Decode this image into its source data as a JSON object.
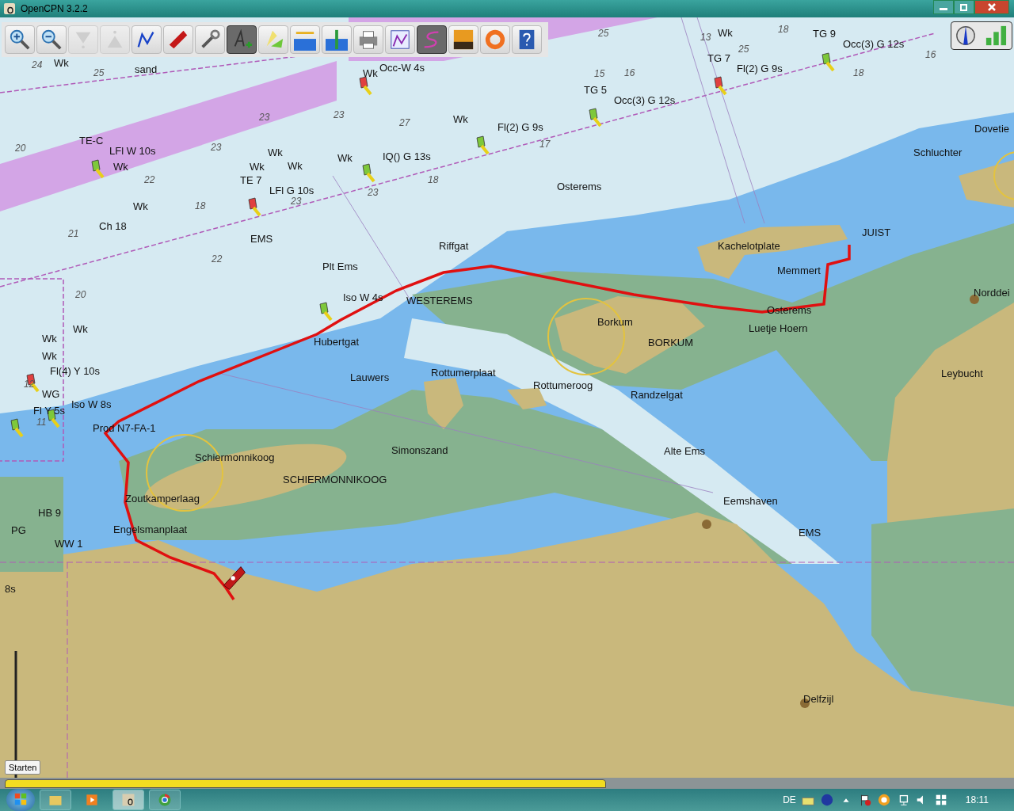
{
  "window": {
    "title": "OpenCPN 3.2.2"
  },
  "toolbar": {
    "tools": [
      {
        "kind": "zoom-in",
        "selected": false,
        "disabled": false
      },
      {
        "kind": "zoom-out",
        "selected": false,
        "disabled": false
      },
      {
        "kind": "scale-down",
        "selected": false,
        "disabled": true
      },
      {
        "kind": "scale-up",
        "selected": false,
        "disabled": true
      },
      {
        "kind": "route",
        "selected": false,
        "disabled": false
      },
      {
        "kind": "ship",
        "selected": false,
        "disabled": false
      },
      {
        "kind": "settings",
        "selected": false,
        "disabled": false
      },
      {
        "kind": "text",
        "selected": true,
        "disabled": false
      },
      {
        "kind": "lights",
        "selected": false,
        "disabled": false
      },
      {
        "kind": "tide",
        "selected": false,
        "disabled": false
      },
      {
        "kind": "current",
        "selected": false,
        "disabled": false
      },
      {
        "kind": "print",
        "selected": false,
        "disabled": false
      },
      {
        "kind": "route-manager",
        "selected": false,
        "disabled": false
      },
      {
        "kind": "track",
        "selected": true,
        "disabled": false
      },
      {
        "kind": "sunset",
        "selected": false,
        "disabled": false
      },
      {
        "kind": "lifebuoy",
        "selected": false,
        "disabled": false
      },
      {
        "kind": "help",
        "selected": false,
        "disabled": false
      }
    ]
  },
  "chart": {
    "labels": [
      "Wk",
      "sand",
      "Wk",
      "Occ-W 4s",
      "Wk",
      "TG 9",
      "Occ(3) G 12s",
      "TG 7",
      "Fl(2) G 9s",
      "TG 5",
      "Occ(3) G 12s",
      "Wk",
      "Fl(2) G 9s",
      "TE-C",
      "LFl W 10s",
      "Wk",
      "Wk",
      "Wk",
      "Wk",
      "Wk",
      "IQ() G 13s",
      "TE 7",
      "LFl G 10s",
      "Osterems",
      "Schluchter",
      "Dovetie",
      "Wk",
      "Ch 18",
      "EMS",
      "Riffgat",
      "JUIST",
      "Kachelotplate",
      "Plt Ems",
      "Memmert",
      "Iso W 4s",
      "WESTEREMS",
      "Osterems",
      "Norddei",
      "Borkum",
      "Luetje Hoern",
      "Hubertgat",
      "BORKUM",
      "Wk",
      "Wk",
      "Wk",
      "Fl(4) Y 10s",
      "Lauwers",
      "Rottumerplaat",
      "Leybucht",
      "WG",
      "Rottumeroog",
      "Randzelgat",
      "Fl Y 5s",
      "Iso W 8s",
      "Prod N7-FA-1",
      "Schiermonnikoog",
      "Simonszand",
      "Alte Ems",
      "SCHIERMONNIKOOG",
      "Zoutkamperlaag",
      "HB 9",
      "Eemshaven",
      "PG",
      "Engelsmanplaat",
      "EMS",
      "WW 1",
      "Delfzijl",
      "8s"
    ],
    "soundings": [
      "25",
      "24",
      "25",
      "18",
      "25",
      "16",
      "18",
      "16",
      "23",
      "23",
      "27",
      "17",
      "23",
      "22",
      "23",
      "18",
      "22",
      "23",
      "18",
      "21",
      "20",
      "20",
      "12",
      "11",
      "15",
      "13"
    ]
  },
  "tooltip": "Starten",
  "taskbar": {
    "language": "DE",
    "clock": "18:11"
  }
}
